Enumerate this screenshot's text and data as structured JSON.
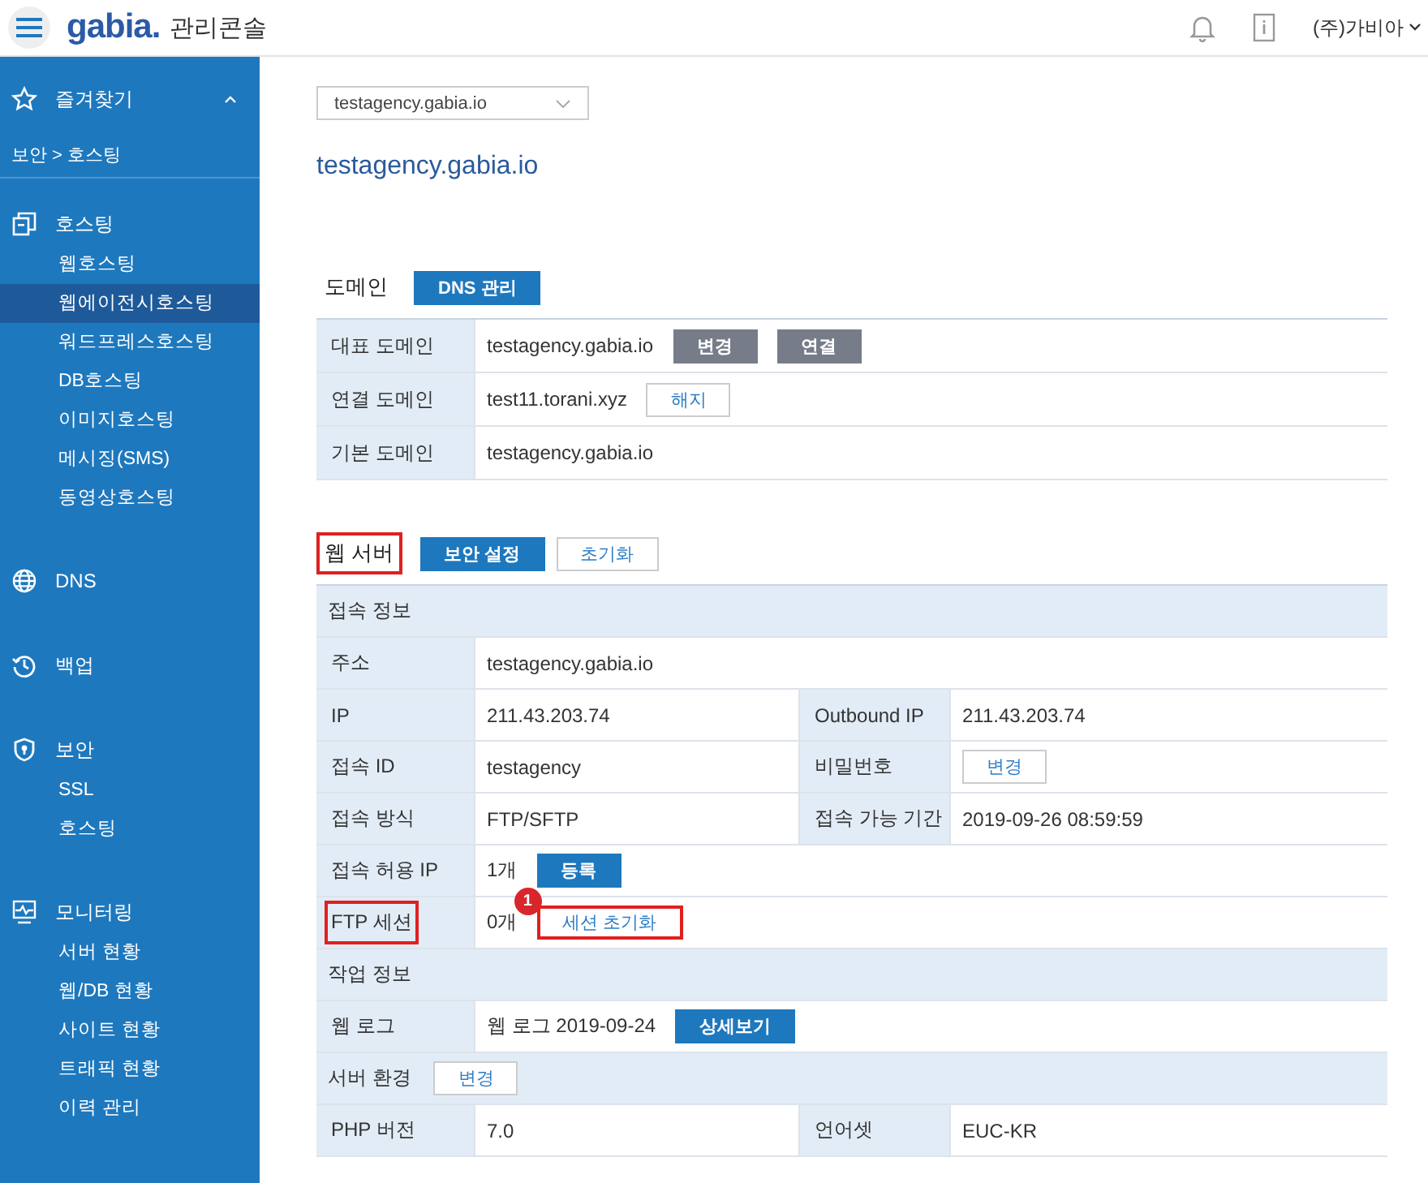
{
  "header": {
    "logo": "gabia.",
    "title": "관리콘솔",
    "user": "(주)가비아"
  },
  "sidebar": {
    "favorites": {
      "label": "즐겨찾기",
      "expanded": true
    },
    "breadcrumb": "보안 > 호스팅",
    "groups": [
      {
        "kind": "hosting",
        "label": "호스팅",
        "children": [
          {
            "label": "웹호스팅",
            "selected": false
          },
          {
            "label": "웹에이전시호스팅",
            "selected": true
          },
          {
            "label": "워드프레스호스팅",
            "selected": false
          },
          {
            "label": "DB호스팅",
            "selected": false
          },
          {
            "label": "이미지호스팅",
            "selected": false
          },
          {
            "label": "메시징(SMS)",
            "selected": false
          },
          {
            "label": "동영상호스팅",
            "selected": false
          }
        ]
      },
      {
        "kind": "globe",
        "label": "DNS"
      },
      {
        "kind": "history",
        "label": "백업"
      },
      {
        "kind": "shield",
        "label": "보안",
        "children": [
          {
            "label": "SSL",
            "selected": false
          },
          {
            "label": "호스팅",
            "selected": false
          }
        ]
      },
      {
        "kind": "monitor",
        "label": "모니터링",
        "children": [
          {
            "label": "서버 현황",
            "selected": false
          },
          {
            "label": "웹/DB 현황",
            "selected": false
          },
          {
            "label": "사이트 현황",
            "selected": false
          },
          {
            "label": "트래픽 현황",
            "selected": false
          },
          {
            "label": "이력 관리",
            "selected": false
          }
        ]
      }
    ]
  },
  "domain_select": {
    "value": "testagency.gabia.io"
  },
  "heading": "testagency.gabia.io",
  "sections": [
    {
      "title": "도메인",
      "highlighted": false,
      "buttons": [
        {
          "label": "DNS 관리",
          "kind": "primary",
          "highlighted": false
        }
      ],
      "rows": [
        {
          "kind": "row",
          "cells": [
            {
              "label": "대표 도메인",
              "value": "testagency.gabia.io",
              "buttons": [
                {
                  "label": "변경",
                  "kind": "gray",
                  "highlighted": false
                },
                {
                  "label": "연결",
                  "kind": "gray",
                  "highlighted": false
                }
              ]
            }
          ]
        },
        {
          "kind": "row",
          "cells": [
            {
              "label": "연결 도메인",
              "value": "test11.torani.xyz",
              "buttons": [
                {
                  "label": "해지",
                  "kind": "outline",
                  "highlighted": false
                }
              ]
            }
          ]
        },
        {
          "kind": "row",
          "cells": [
            {
              "label": "기본 도메인",
              "value": "testagency.gabia.io"
            }
          ]
        }
      ]
    },
    {
      "title": "웹 서버",
      "highlighted": true,
      "buttons": [
        {
          "label": "보안 설정",
          "kind": "primary",
          "highlighted": false
        },
        {
          "label": "초기화",
          "kind": "outline",
          "highlighted": false
        }
      ],
      "rows": [
        {
          "kind": "header",
          "label": "접속 정보"
        },
        {
          "kind": "row",
          "cells": [
            {
              "label": "주소",
              "value": "testagency.gabia.io"
            }
          ]
        },
        {
          "kind": "row",
          "cells": [
            {
              "label": "IP",
              "value": "211.43.203.74"
            },
            {
              "label": "Outbound IP",
              "value": "211.43.203.74"
            }
          ]
        },
        {
          "kind": "row",
          "cells": [
            {
              "label": "접속 ID",
              "value": "testagency"
            },
            {
              "label": "비밀번호",
              "buttons": [
                {
                  "label": "변경",
                  "kind": "outline",
                  "highlighted": false
                }
              ]
            }
          ]
        },
        {
          "kind": "row",
          "cells": [
            {
              "label": "접속 방식",
              "value": "FTP/SFTP"
            },
            {
              "label": "접속 가능 기간",
              "value": "2019-09-26 08:59:59"
            }
          ]
        },
        {
          "kind": "row",
          "cells": [
            {
              "label": "접속 허용 IP",
              "value": "1개",
              "buttons": [
                {
                  "label": "등록",
                  "kind": "primary",
                  "highlighted": false
                }
              ]
            }
          ]
        },
        {
          "kind": "row",
          "cells": [
            {
              "label": "FTP 세션",
              "highlighted": true,
              "value": "0개",
              "buttons": [
                {
                  "label": "세션 초기화",
                  "kind": "outline",
                  "highlighted": true,
                  "badge": "1"
                }
              ]
            }
          ]
        },
        {
          "kind": "header",
          "label": "작업 정보"
        },
        {
          "kind": "row",
          "cells": [
            {
              "label": "웹 로그",
              "value": "웹 로그 2019-09-24",
              "buttons": [
                {
                  "label": "상세보기",
                  "kind": "primary",
                  "highlighted": false
                }
              ]
            }
          ]
        },
        {
          "kind": "header",
          "label": "서버 환경",
          "buttons": [
            {
              "label": "변경",
              "kind": "outline",
              "highlighted": false
            }
          ]
        },
        {
          "kind": "row",
          "cells": [
            {
              "label": "PHP 버전",
              "value": "7.0"
            },
            {
              "label": "언어셋",
              "value": "EUC-KR"
            }
          ]
        }
      ]
    }
  ]
}
